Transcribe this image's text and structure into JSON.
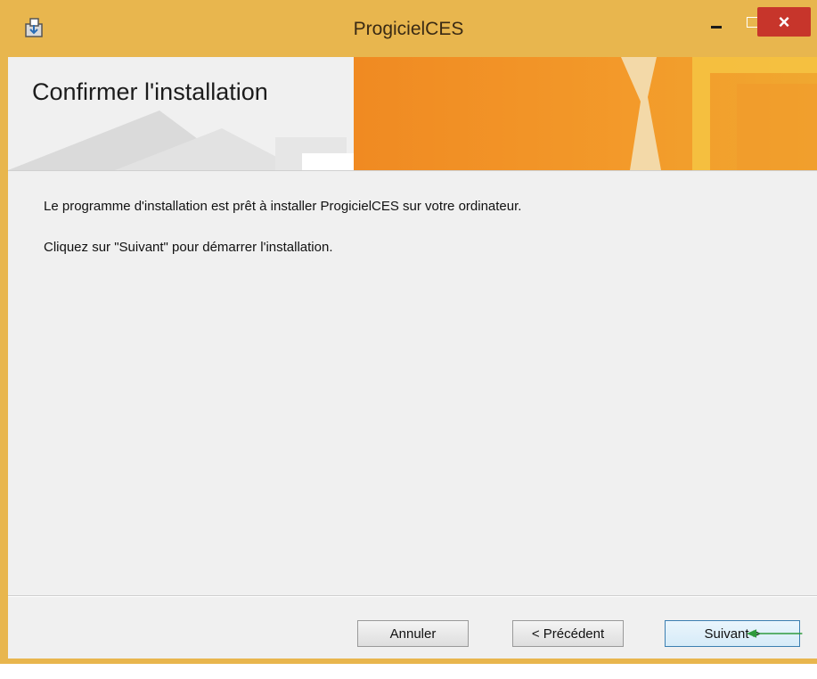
{
  "window": {
    "title": "ProgicielCES",
    "close_glyph": "×",
    "icons": {
      "app": "installer-icon",
      "minimize": "minimize-icon",
      "maximize": "maximize-icon",
      "close": "close-icon"
    },
    "colors": {
      "frame": "#e8b64e",
      "close": "#c7352b",
      "banner": "#f08a22"
    }
  },
  "banner": {
    "title": "Confirmer l'installation"
  },
  "content": {
    "line1": "Le programme d'installation est prêt à installer ProgicielCES sur votre ordinateur.",
    "line2": "Cliquez sur \"Suivant\" pour démarrer l'installation."
  },
  "buttons": {
    "cancel": "Annuler",
    "previous": "< Précédent",
    "next": "Suivant >"
  },
  "annotation": {
    "arrow_color": "#2e9a3c"
  }
}
